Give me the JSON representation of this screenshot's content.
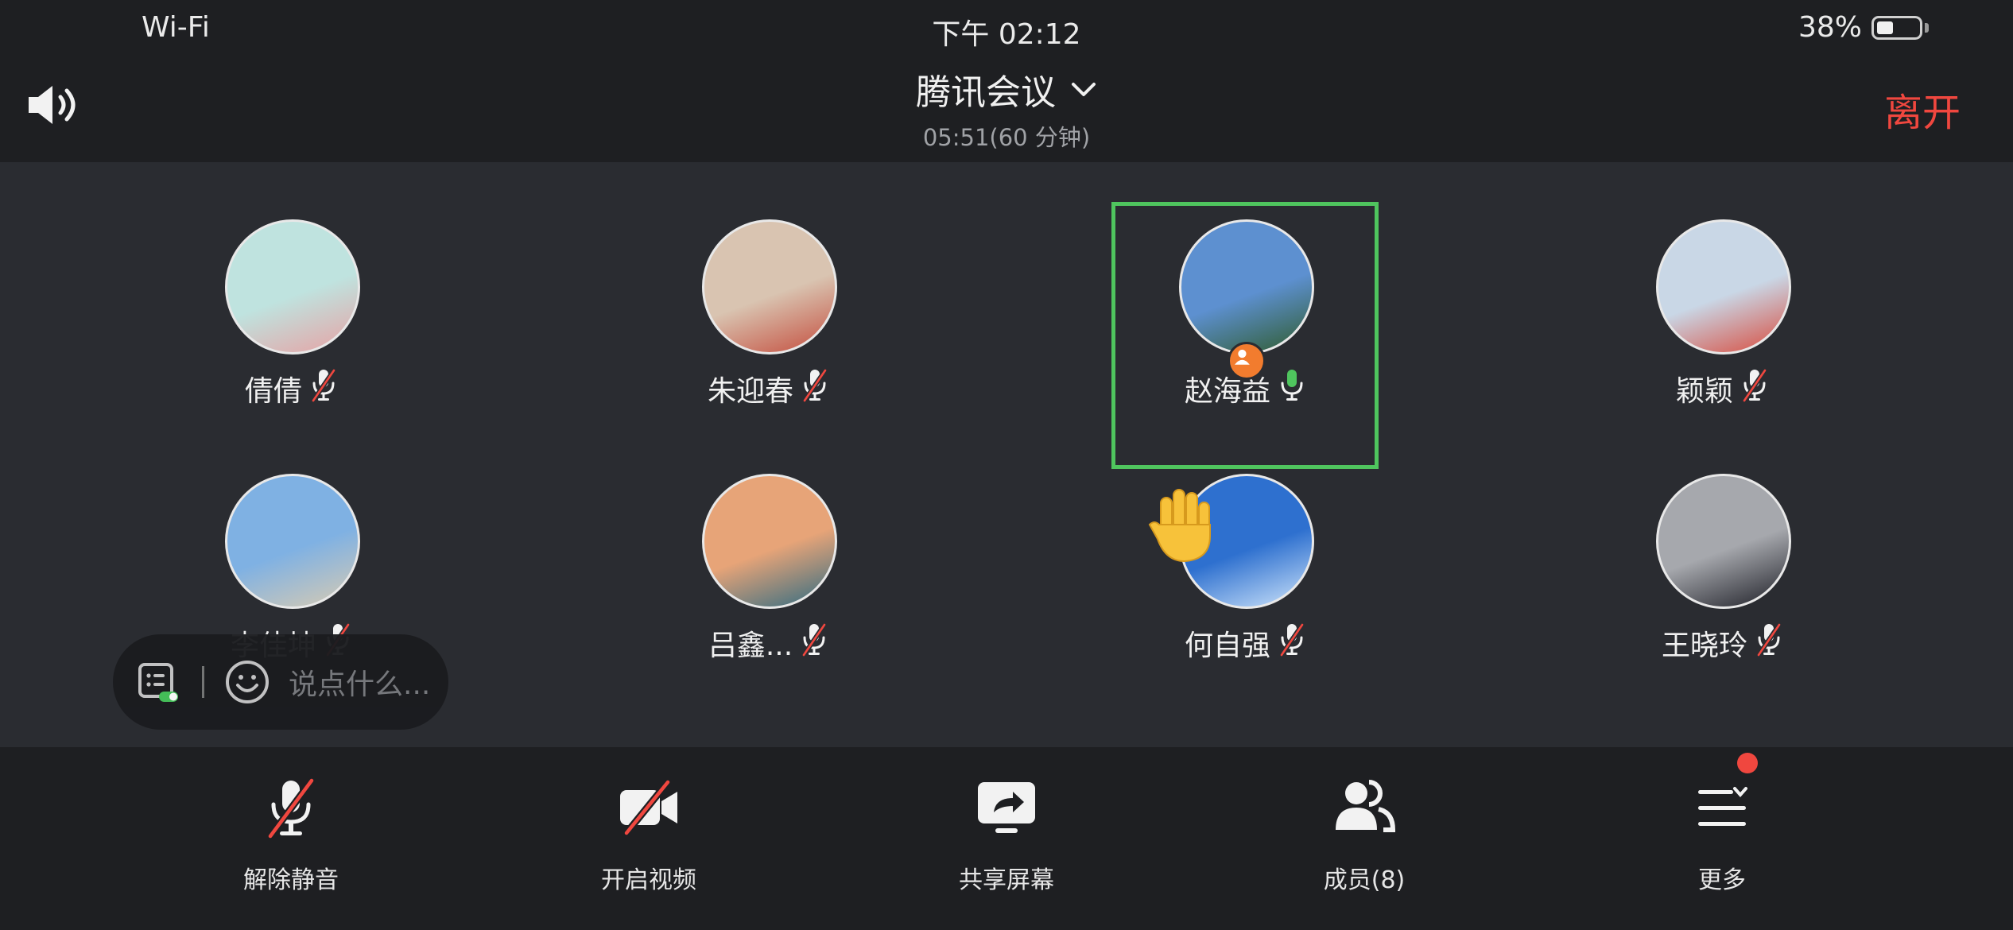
{
  "status": {
    "wifi": "Wi-Fi",
    "time": "下午 02:12",
    "battery": "38%",
    "battery_level": 0.38
  },
  "header": {
    "title": "腾讯会议",
    "duration": "05:51(60 分钟)",
    "leave_label": "离开"
  },
  "participants": [
    {
      "name": "倩倩",
      "mic": "muted",
      "avatar_colors": [
        "#bfe3df",
        "#e7a1a3"
      ]
    },
    {
      "name": "朱迎春",
      "mic": "muted",
      "avatar_colors": [
        "#d9c4b1",
        "#c44d3d"
      ]
    },
    {
      "name": "赵海益",
      "mic": "active",
      "host": true,
      "avatar_colors": [
        "#5d90d0",
        "#2f5b2c"
      ]
    },
    {
      "name": "颖颖",
      "mic": "muted",
      "avatar_colors": [
        "#c9d7e6",
        "#d84a3c"
      ]
    },
    {
      "name": "李佳坤",
      "mic": "muted",
      "avatar_colors": [
        "#7fb1e3",
        "#d8cbb2"
      ]
    },
    {
      "name": "吕鑫...",
      "mic": "muted",
      "avatar_colors": [
        "#e7a478",
        "#2e6b82"
      ]
    },
    {
      "name": "何自强",
      "mic": "muted",
      "hand_raised": true,
      "avatar_colors": [
        "#2e70cf",
        "#cfe5fb"
      ]
    },
    {
      "name": "王晓玲",
      "mic": "muted",
      "avatar_colors": [
        "#a6a8ad",
        "#1d1e26"
      ]
    }
  ],
  "chat": {
    "placeholder": "说点什么..."
  },
  "toolbar": {
    "unmute": "解除静音",
    "start_video": "开启视频",
    "share_screen": "共享屏幕",
    "members": "成员(8)",
    "more": "更多"
  },
  "colors": {
    "accent_green": "#4fc55e",
    "leave_red": "#f0473f",
    "host_orange": "#f27c2e"
  }
}
